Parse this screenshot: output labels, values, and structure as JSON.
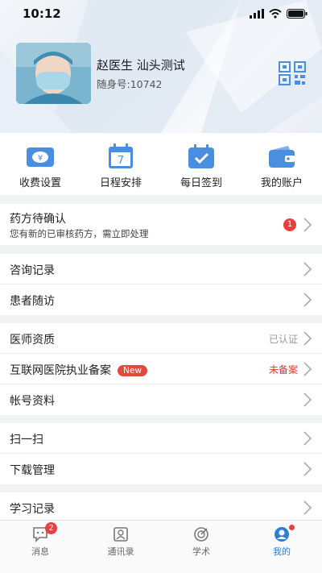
{
  "status_bar": {
    "time": "10:12"
  },
  "profile": {
    "name": "赵医生 汕头测试",
    "id_label": "随身号:10742"
  },
  "quick_actions": [
    {
      "label": "收费设置",
      "icon": "fee-icon"
    },
    {
      "label": "日程安排",
      "icon": "calendar-icon",
      "icon_text": "7"
    },
    {
      "label": "每日签到",
      "icon": "checkin-icon"
    },
    {
      "label": "我的账户",
      "icon": "wallet-icon"
    }
  ],
  "prescription": {
    "title": "药方待确认",
    "subtitle": "您有新的已审核药方，需立即处理",
    "badge": "1"
  },
  "group1": [
    {
      "title": "咨询记录"
    },
    {
      "title": "患者随访"
    }
  ],
  "group2": {
    "qualification": {
      "title": "医师资质",
      "status": "已认证"
    },
    "filing": {
      "title": "互联网医院执业备案",
      "tag": "New",
      "status": "未备案"
    },
    "account": {
      "title": "帐号资料"
    }
  },
  "group3": [
    {
      "title": "扫一扫"
    },
    {
      "title": "下载管理"
    }
  ],
  "group4": [
    {
      "title": "学习记录"
    }
  ],
  "tabbar": {
    "tabs": [
      {
        "label": "消息",
        "badge": "2"
      },
      {
        "label": "通讯录"
      },
      {
        "label": "学术"
      },
      {
        "label": "我的"
      }
    ]
  },
  "colors": {
    "accent": "#2a7fd6",
    "icon_blue": "#4a8ee0",
    "badge_red": "#e8413c",
    "status_red": "#e0382f",
    "status_gray": "#999999"
  }
}
